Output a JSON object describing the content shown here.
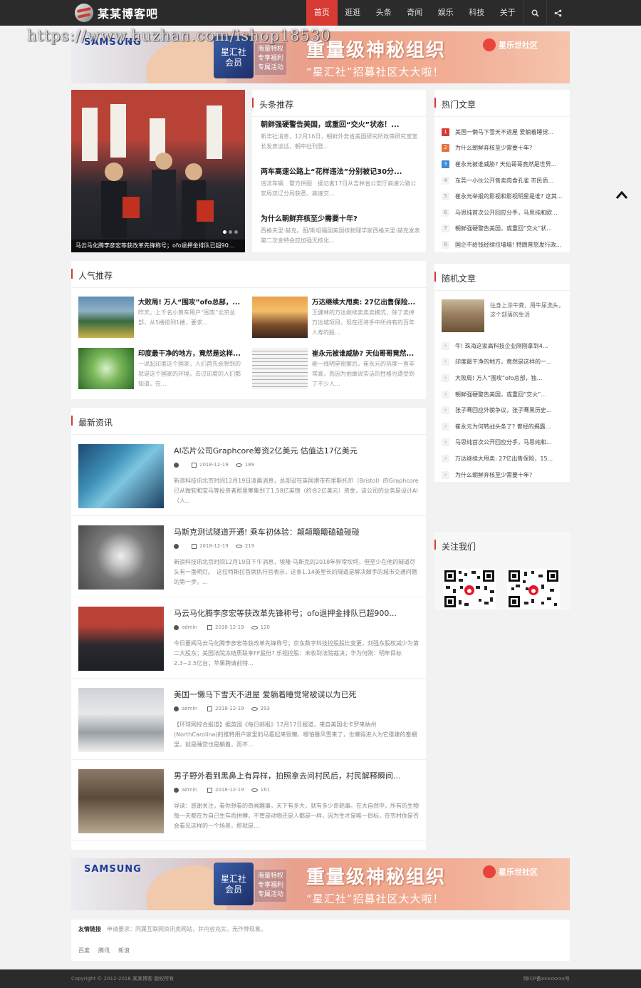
{
  "header": {
    "site_name": "某某博客吧",
    "nav": [
      "首页",
      "逛逛",
      "头条",
      "奇闻",
      "娱乐",
      "科技",
      "关于"
    ],
    "icons": [
      "search-icon",
      "share-icon"
    ]
  },
  "watermark": "https://www.huzhan.com/ishop18530",
  "banner": {
    "brand_left": "SAMSUNG",
    "card_text": [
      "星汇社",
      "会员"
    ],
    "perks": [
      "海量特权",
      "专享福利",
      "专属活动"
    ],
    "headline": "重量级神秘组织",
    "subline": "“星汇社”招募社区大大啦！",
    "brand_right": "星乐世社区"
  },
  "slider": {
    "caption": "马云马化腾李彦宏等获改革先锋称号；ofo退押金排队已超90..."
  },
  "headlines": {
    "title": "头条推荐",
    "items": [
      {
        "title": "朝鲜强硬警告美国，或重回“交火”状态！...",
        "summary": "新华社消息，12月16日，朝鲜外务省美国研究所政策研究室室长发表谈话，朝中社刊登..."
      },
      {
        "title": "两车高速公路上“花样违法”分别被记30分...",
        "summary": "违法车辆　警方供图　据记者17日从吉林省公安厅高速公路公安局双辽分局获悉，高速交..."
      },
      {
        "title": "为什么朝鲜弃核至少需要十年?",
        "summary": "西格夫里·赫克。图/斯坦福国美国核物理学家西格夫里·赫克发表第二次金特会应加强无核化..."
      }
    ]
  },
  "hot": {
    "title": "热门文章",
    "items": [
      "美国一懒马下雪天不进屋 爱躺着睡觉...",
      "为什么朝鲜弃核至少需要十年?",
      "崔永元被谁威胁? 天仙哥哥竟然是世界...",
      "东莞一小伙公开售卖肉食孔雀 市民质...",
      "崔永元举报的影视和影视明星是谁? 这其...",
      "马思纯首次公开回应分手，马思纯和欧...",
      "朝鲜强硬警告美国，或重回“交火”状...",
      "国企不给钱经续拉墙墙! 特朗普怒发行政..."
    ]
  },
  "popular": {
    "title": "人气推荐",
    "items": [
      {
        "title": "大败局! 万人“围攻”ofo总部，...",
        "summary": "昨天，上千名小黄车用户“围攻”北京总部，从5楼排到1楼，要求..."
      },
      {
        "title": "万达继续大甩卖: 27亿出售保险...",
        "summary": "王健林的万达继续卖卖卖模式，除了卖掉万达城项目，现在还将手中所持有的百年人寿的股..."
      },
      {
        "title": "印度最干净的地方，竟然是这样...",
        "summary": "一说起印度这个国家，人们首先会想到的就是这个国家的环境，去过印度的人们都知道，在..."
      },
      {
        "title": "崔永元被谁威胁? 天仙哥哥竟然...",
        "summary": "继一线明星税案后，崔永元的热度一直非常高，而因为他敢说实话的性格也遭受到了不少人..."
      }
    ]
  },
  "random": {
    "title": "随机文章",
    "featured": "往身上涂牛粪，用牛尿洗头，这个部落的生活",
    "items": [
      "牛! 珠海这家高科技企业刚刚拿到4...",
      "印度最干净的地方，竟然是这样的一...",
      "大败局! 万人“围攻”ofo总部，独...",
      "朝鲜强硬警告美国，或重回“交火”...",
      "张子骞回应外貌争议，张子骞黑历史...",
      "崔永元为何转战头条了? 曾经的揭露...",
      "马思纯首次公开回应分手，马思纯和...",
      "万达继续大甩卖: 27亿出售保险，15...",
      "为什么朝鲜弃核至少需要十年?"
    ]
  },
  "latest": {
    "title": "最新资讯",
    "items": [
      {
        "title": "AI芯片公司Graphcore筹资2亿美元 估值达17亿美元",
        "author": "",
        "date": "2018-12-19",
        "views": "189",
        "summary": "新浪科技讯北京时间12月19日凌晨消息，总部设在英国港市布里斯托尔（Bristol）的Graphcore已从微软和宝马等投资者那里筹集到了1.58亿英镑（约合2亿美元）资金，该公司的业务是设计AI（人..."
      },
      {
        "title": "马斯克测试隧道开通! 乘车初体验：颠颠簸簸磕磕碰碰",
        "author": "",
        "date": "2018-12-19",
        "views": "219",
        "summary": "新浪科技讯北京时间12月19日下午消息，埃隆·马斯克的2018年异常坎坷，但至少在他的隧道尽头有一盏明灯。　这位特斯拉首席执行官表示，这条1.14英里长的隧道是解决棘手的城市交通问题的第一步。..."
      },
      {
        "title": "马云马化腾李彦宏等获改革先锋称号；ofo退押金排队已超900...",
        "author": "admin",
        "date": "2018-12-19",
        "views": "120",
        "summary": "今日要闻马云马化腾李彦宏等获改革先锋称号；京东数字科技控股股比变更，刘强东股权减少为第二大股东；美国法院冻结质联享FF股份? 乐视控股：未收到法院裁决；华为何刚：明年目标2.3~2.5亿台；苹果聘请前特..."
      },
      {
        "title": "美国一懒马下雪天不进屋 爱躺着睡觉常被误以为已死",
        "author": "admin",
        "date": "2018-12-19",
        "views": "293",
        "summary": "【环球网综合报道】据英国《每日邮报》12月17日报道，来自美国北卡罗来纳州(NorthCarolina)的推特用户家里的马看起来很懒，哪怕暴风雪来了，也懒得进入为它搭建的畜棚里，就是睡觉也是躺着，而不..."
      },
      {
        "title": "男子野外看到黑鼻上有异样，拍照拿去问村民后，村民解释瞬间...",
        "author": "admin",
        "date": "2018-12-19",
        "views": "161",
        "summary": "导读：感谢关注，看你想看的奇闻趣事，天下有多大，就有多少奇葩事。在大自然中，所有的生物每一天都在为自己生存而拼搏，不管是动物还是人都是一样，因为生才是唯一目标，在农村你是否会看见这样的一个场景，那就是..."
      }
    ]
  },
  "follow": {
    "title": "关注我们"
  },
  "links": {
    "label": "友情链接",
    "note": "申请要求：同属互联网资讯类网站，并内容充实，无作弊现象。",
    "items": [
      "百度",
      "腾讯",
      "新浪"
    ]
  },
  "footer": {
    "copyright": "Copyright © 2012-2018 某某博客 版权所有",
    "icp": "琼ICP备xxxxxxxx号"
  }
}
